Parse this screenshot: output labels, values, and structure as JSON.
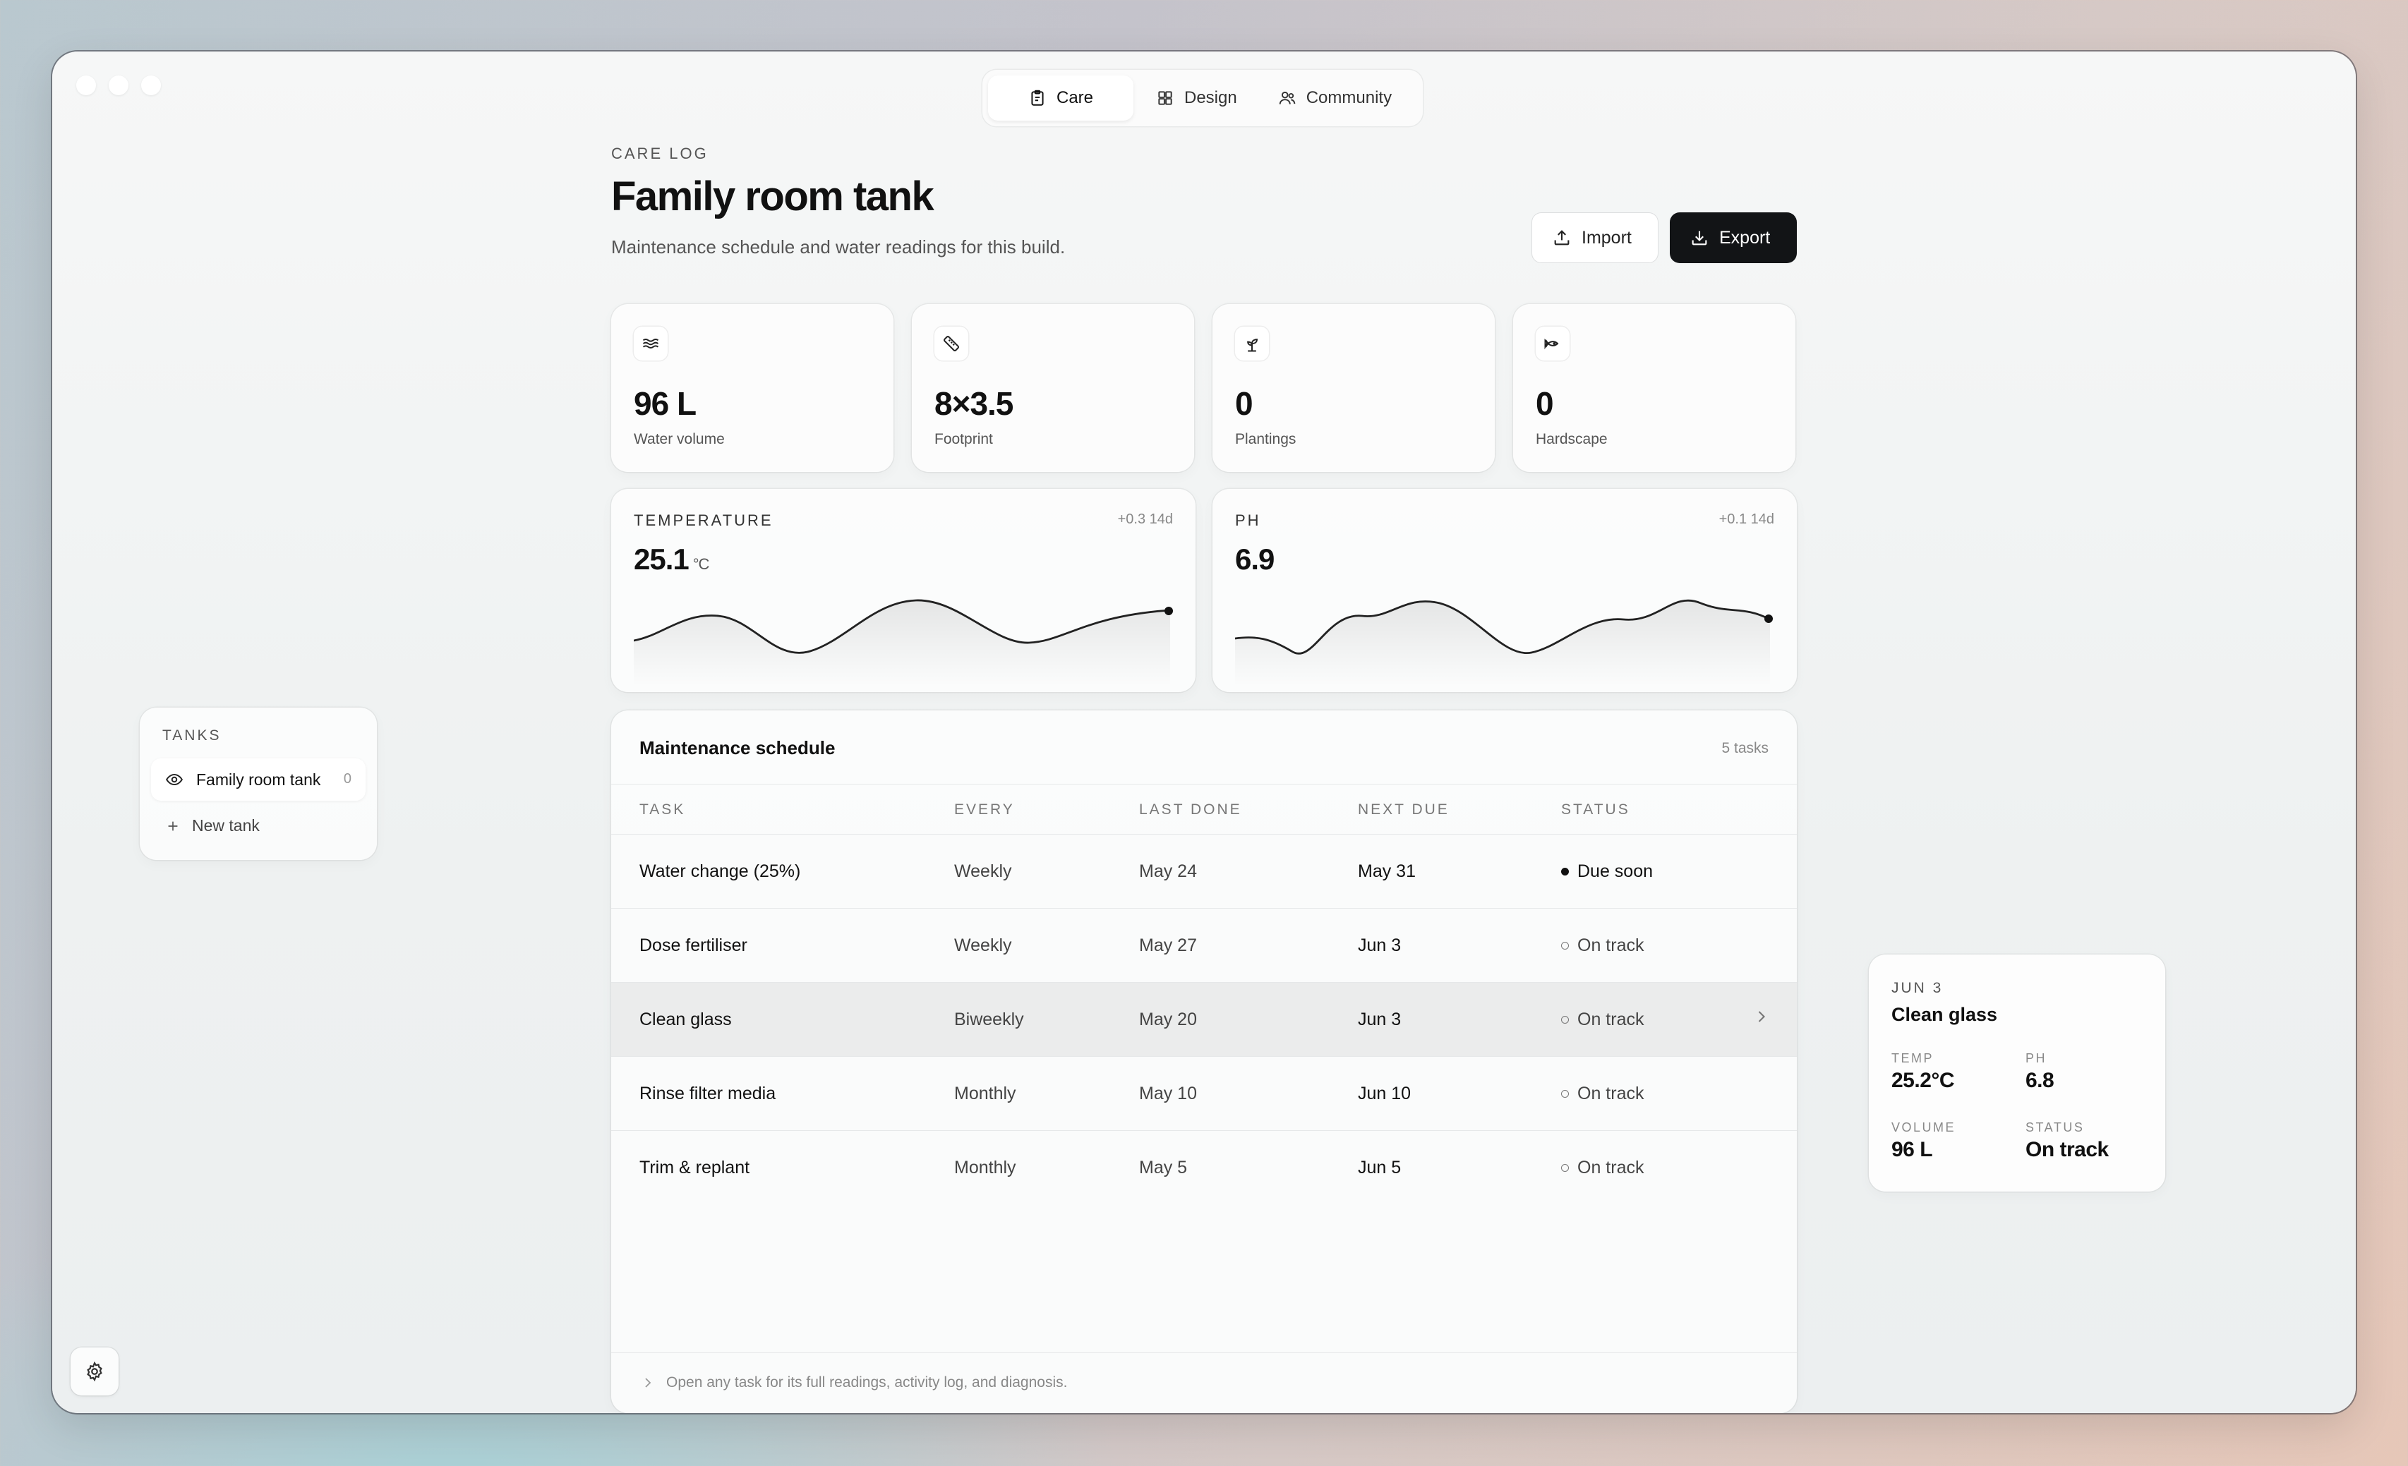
{
  "tabs": [
    {
      "label": "Care",
      "icon": "clipboard-icon",
      "active": true
    },
    {
      "label": "Design",
      "icon": "grid-icon",
      "active": false
    },
    {
      "label": "Community",
      "icon": "users-icon",
      "active": false
    }
  ],
  "header": {
    "eyebrow": "CARE LOG",
    "title": "Family room tank",
    "subtitle": "Maintenance schedule and water readings for this build.",
    "import_label": "Import",
    "export_label": "Export"
  },
  "stats": [
    {
      "value": "96 L",
      "label": "Water volume",
      "icon": "waves-icon"
    },
    {
      "value": "8×3.5",
      "label": "Footprint",
      "icon": "ruler-icon"
    },
    {
      "value": "0",
      "label": "Plantings",
      "icon": "sprout-icon"
    },
    {
      "value": "0",
      "label": "Hardscape",
      "icon": "fish-icon"
    }
  ],
  "readings": {
    "temperature": {
      "label": "TEMPERATURE",
      "delta": "+0.3 14d",
      "value": "25.1",
      "unit": "°C"
    },
    "ph": {
      "label": "PH",
      "delta": "+0.1 14d",
      "value": "6.9"
    }
  },
  "schedule": {
    "title": "Maintenance schedule",
    "count": "5 tasks",
    "columns": [
      "TASK",
      "EVERY",
      "LAST DONE",
      "NEXT DUE",
      "STATUS"
    ],
    "rows": [
      {
        "task": "Water change (25%)",
        "every": "Weekly",
        "last": "May 24",
        "next": "May 31",
        "status": "Due soon"
      },
      {
        "task": "Dose fertiliser",
        "every": "Weekly",
        "last": "May 27",
        "next": "Jun 3",
        "status": "On track"
      },
      {
        "task": "Clean glass",
        "every": "Biweekly",
        "last": "May 20",
        "next": "Jun 3",
        "status": "On track"
      },
      {
        "task": "Rinse filter media",
        "every": "Monthly",
        "last": "May 10",
        "next": "Jun 10",
        "status": "On track"
      },
      {
        "task": "Trim & replant",
        "every": "Monthly",
        "last": "May 5",
        "next": "Jun 5",
        "status": "On track"
      }
    ],
    "footer": "Open any task for its full readings, activity log, and diagnosis."
  },
  "tanks": {
    "heading": "TANKS",
    "items": [
      {
        "name": "Family room tank",
        "count": "0"
      }
    ],
    "new_label": "New tank"
  },
  "detail": {
    "date": "JUN 3",
    "title": "Clean glass",
    "temp_label": "TEMP",
    "temp_value": "25.2°C",
    "ph_label": "PH",
    "ph_value": "6.8",
    "volume_label": "VOLUME",
    "volume_value": "96 L",
    "status_label": "STATUS",
    "status_value": "On track"
  }
}
